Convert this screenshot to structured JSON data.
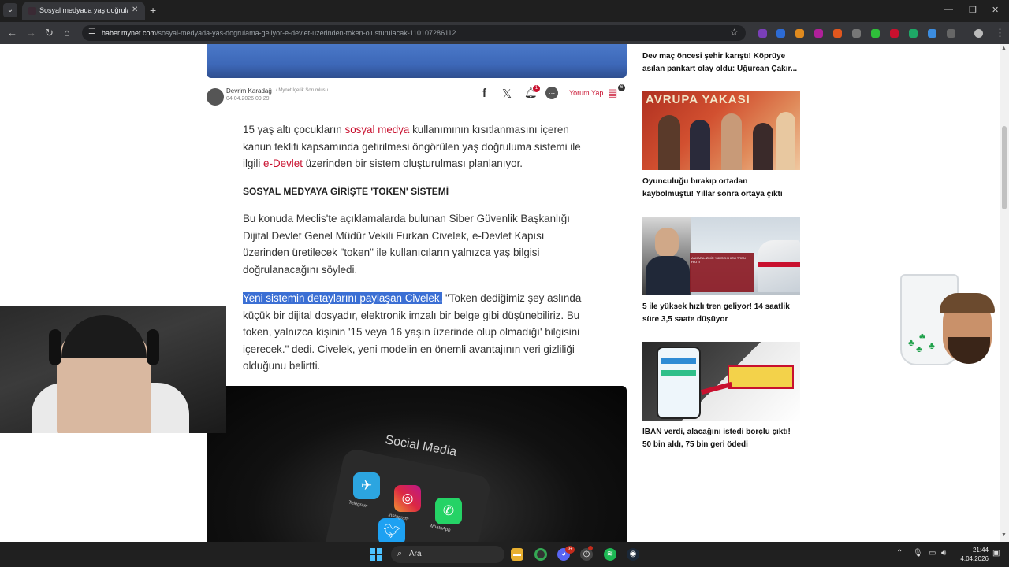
{
  "browser": {
    "tab_title": "Sosyal medyada yaş doğrulama",
    "url_host": "haber.mynet.com",
    "url_path": "/sosyal-medyada-yas-dogrulama-geliyor-e-devlet-uzerinden-token-olusturulacak-110107286112"
  },
  "author": {
    "name": "Devrim Karadağ",
    "role": "/ Mynet İçerik Sorumlusu",
    "date": "04.04.2026 09:29"
  },
  "share": {
    "bell_count": "1",
    "comment_label": "Yorum Yap",
    "comment_count": "6"
  },
  "article": {
    "p1_a": "15 yaş altı çocukların ",
    "p1_link1": "sosyal medya",
    "p1_b": " kullanımının kısıtlanmasını içeren kanun teklifi kapsamında getirilmesi öngörülen yaş doğruluma sistemi ile ilgili ",
    "p1_link2": "e-Devlet",
    "p1_c": " üzerinden bir sistem oluşturulması planlanıyor.",
    "section_title": "SOSYAL MEDYAYA GİRİŞTE 'TOKEN' SİSTEMİ",
    "p2": "Bu konuda Meclis'te açıklamalarda bulunan Siber Güvenlik Başkanlığı Dijital Devlet Genel Müdür Vekili Furkan Civelek, e-Devlet Kapısı üzerinden üretilecek \"token\" ile kullanıcıların yalnızca yaş bilgisi doğrulanacağını söyledi.",
    "p3_highlight": "Yeni sistemin detaylarını paylaşan Civelek,",
    "p3_rest": " \"Token dediğimiz şey aslında küçük bir dijital dosyadır, elektronik imzalı bir belge gibi düşünebiliriz. Bu token, yalnızca kişinin '15 veya 16 yaşın üzerinde olup olmadığı' bilgisini içerecek.\" dedi. Civelek, yeni modelin en önemli avantajının veri gizliliği olduğunu belirtti.",
    "image_text": "Social Media",
    "app_labels": [
      "Telegram",
      "Instagram",
      "WhatsApp"
    ]
  },
  "sidebar": {
    "top_title": "Dev maç öncesi şehir karıştı! Köprüye asılan pankart olay oldu: Uğurcan Çakır...",
    "items": [
      {
        "title": "Oyunculuğu bırakıp ortadan kaybolmuştu! Yıllar sonra ortaya çıktı",
        "thumb_text": "AVRUPA YAKASI"
      },
      {
        "title": "5 ile yüksek hızlı tren geliyor! 14 saatlik süre 3,5 saate düşüyor",
        "thumb_text": "ANKARA-İZMİR YÜKSEK HIZLI TREN HATTI"
      },
      {
        "title": "IBAN verdi, alacağını istedi borçlu çıktı! 50 bin aldı, 75 bin geri ödedi",
        "thumb_text": ""
      }
    ]
  },
  "taskbar": {
    "search_label": "Ara",
    "discord_badge": "9+",
    "time": "21:44",
    "date": "4.04.2026"
  },
  "colors": {
    "accent": "#c8102e",
    "highlight": "#3b6fd4"
  }
}
